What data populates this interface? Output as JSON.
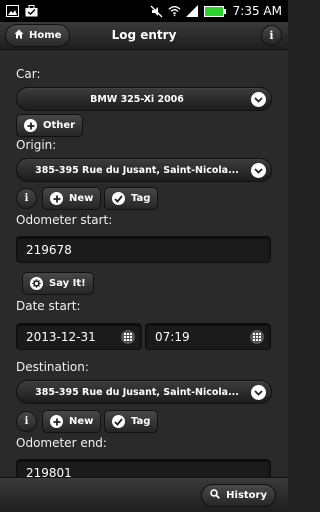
{
  "status_bar": {
    "time": "7:35 AM",
    "icons": [
      "gallery-icon",
      "briefcase-icon",
      "mute-icon",
      "wifi-icon",
      "signal-icon",
      "battery-icon"
    ]
  },
  "header": {
    "home_label": "Home",
    "title": "Log entry"
  },
  "form": {
    "car_label": "Car:",
    "car_value": "BMW 325-Xi 2006",
    "other_label": "Other",
    "origin_label": "Origin:",
    "origin_value": "385-395 Rue du Jusant, Saint-Nicola...",
    "origin_new_label": "New",
    "origin_tag_label": "Tag",
    "odometer_start_label": "Odometer start:",
    "odometer_start_value": "219678",
    "say_it_label": "Say It!",
    "date_start_label": "Date start:",
    "date_start_value": "2013-12-31",
    "time_start_value": "07:19",
    "destination_label": "Destination:",
    "destination_value": "385-395 Rue du Jusant, Saint-Nicola...",
    "dest_new_label": "New",
    "dest_tag_label": "Tag",
    "odometer_end_label": "Odometer end:",
    "odometer_end_value": "219801"
  },
  "footer": {
    "history_label": "History"
  }
}
